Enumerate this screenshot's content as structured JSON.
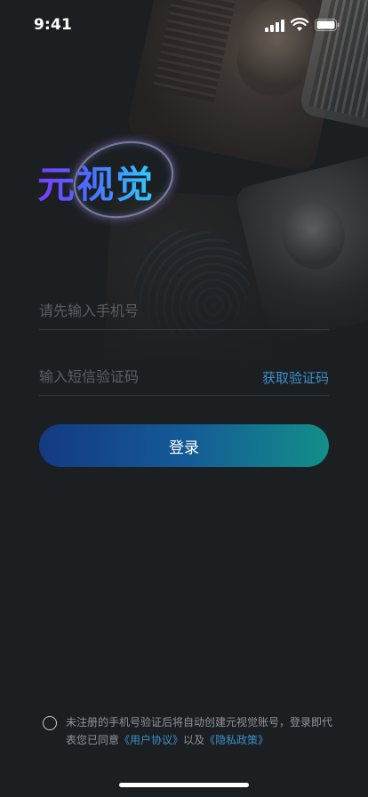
{
  "status": {
    "time": "9:41"
  },
  "logo": {
    "text": "元视觉"
  },
  "form": {
    "phone_placeholder": "请先输入手机号",
    "code_placeholder": "输入短信验证码",
    "get_code_label": "获取验证码",
    "login_label": "登录"
  },
  "agreement": {
    "text_before": "未注册的手机号验证后将自动创建元视觉账号，登录即代表您已同意",
    "user_agreement": "《用户协议》",
    "joiner": "以及",
    "privacy_policy": "《隐私政策》"
  },
  "colors": {
    "accent": "#3b8fc9",
    "background": "#1c1f22",
    "button_start": "#133a82",
    "button_end": "#138f88"
  },
  "icons": [
    "signal-icon",
    "wifi-icon",
    "battery-icon",
    "radio-icon"
  ]
}
